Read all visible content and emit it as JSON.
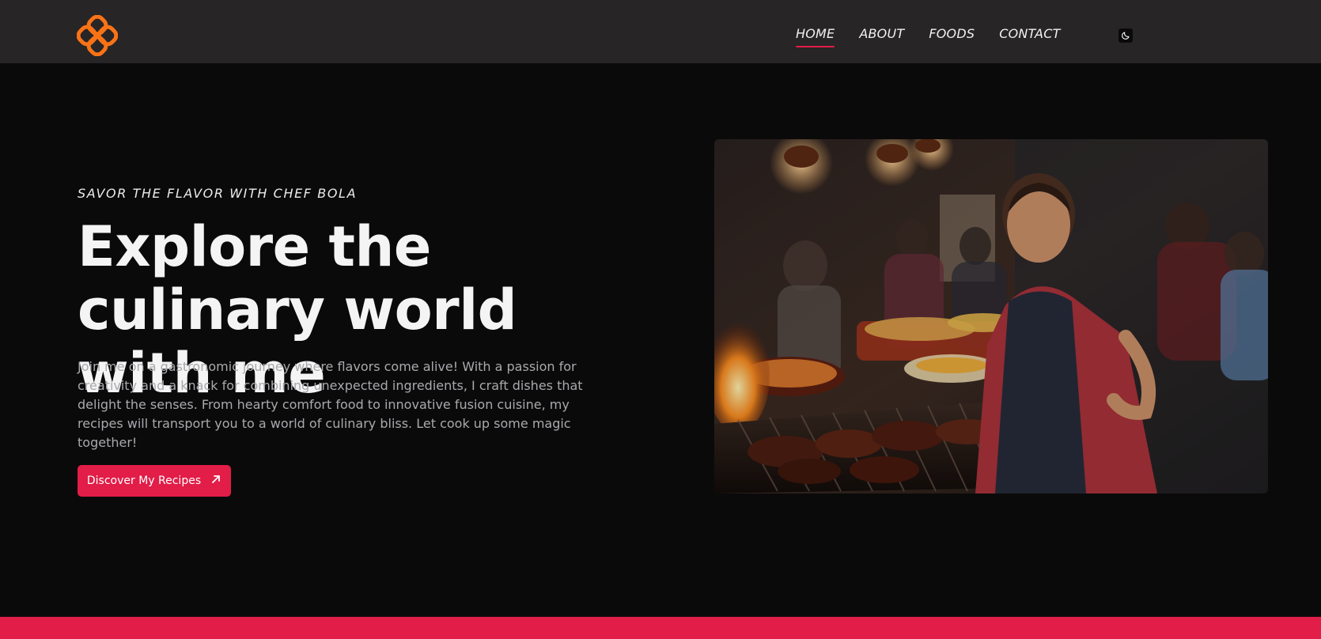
{
  "nav": {
    "logo_icon": "clover-logo-icon",
    "links": [
      {
        "label": "HOME",
        "active": true
      },
      {
        "label": "ABOUT",
        "active": false
      },
      {
        "label": "FOODS",
        "active": false
      },
      {
        "label": "CONTACT",
        "active": false
      }
    ],
    "theme_toggle_icon": "moon-icon"
  },
  "hero": {
    "eyebrow": "SAVOR THE FLAVOR WITH CHEF BOLA",
    "headline": "Explore the culinary world with me",
    "lead": "Join me on a gastronomic journey where flavors come alive! With a passion for creativity and a knack for combining unexpected ingredients, I craft dishes that delight the senses. From hearty comfort food to innovative fusion cuisine, my recipes will transport you to a world of culinary bliss. Let cook up some magic together!",
    "cta_label": "Discover My Recipes",
    "cta_icon": "arrow-up-right-icon",
    "image_icon": "chef-photo"
  },
  "colors": {
    "accent": "#e11d48",
    "logo": "#f97316",
    "nav_bg": "#282526",
    "page_bg": "#0b0a0a"
  }
}
